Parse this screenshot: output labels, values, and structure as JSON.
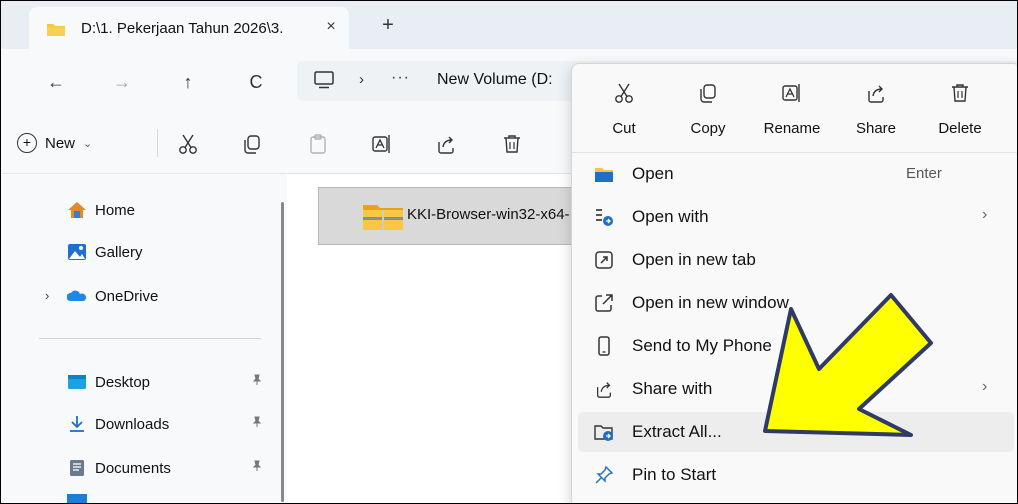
{
  "tab": {
    "title": "D:\\1. Pekerjaan Tahun 2026\\3.",
    "close_glyph": "×",
    "new_tab_glyph": "+"
  },
  "nav": {
    "back": "←",
    "forward": "→",
    "up": "↑",
    "refresh": "C"
  },
  "address": {
    "separator": "›",
    "more": "···",
    "volume": "New Volume (D:"
  },
  "command_bar": {
    "new_label": "New",
    "new_chevron": "⌄"
  },
  "sidebar": {
    "items": [
      {
        "label": "Home",
        "icon": "home-icon"
      },
      {
        "label": "Gallery",
        "icon": "gallery-icon"
      },
      {
        "label": "OneDrive",
        "icon": "onedrive-icon",
        "expander": "›"
      },
      {
        "label": "Desktop",
        "icon": "desktop-icon",
        "pin": "📌"
      },
      {
        "label": "Downloads",
        "icon": "download-icon",
        "pin": "📌"
      },
      {
        "label": "Documents",
        "icon": "documents-icon",
        "pin": "📌"
      }
    ]
  },
  "file": {
    "name": "KKI-Browser-win32-x64-"
  },
  "context_menu": {
    "actions": [
      {
        "label": "Cut",
        "icon": "scissors-icon"
      },
      {
        "label": "Copy",
        "icon": "copy-icon"
      },
      {
        "label": "Rename",
        "icon": "rename-icon"
      },
      {
        "label": "Share",
        "icon": "share-icon"
      },
      {
        "label": "Delete",
        "icon": "trash-icon"
      }
    ],
    "items": [
      {
        "label": "Open",
        "shortcut": "Enter",
        "icon": "folder-icon"
      },
      {
        "label": "Open with",
        "submenu": "›",
        "icon": "open-with-icon"
      },
      {
        "label": "Open in new tab",
        "icon": "new-tab-icon"
      },
      {
        "label": "Open in new window",
        "icon": "new-window-icon"
      },
      {
        "label": "Send to My Phone",
        "icon": "phone-icon"
      },
      {
        "label": "Share with",
        "submenu": "›",
        "icon": "share-icon"
      },
      {
        "label": "Extract All...",
        "icon": "extract-icon"
      },
      {
        "label": "Pin to Start",
        "icon": "pin-icon"
      }
    ]
  },
  "colors": {
    "arrow_fill": "#ffff00",
    "arrow_stroke": "#2f3a66",
    "folder": "#f4c542",
    "accent": "#0067c0"
  }
}
